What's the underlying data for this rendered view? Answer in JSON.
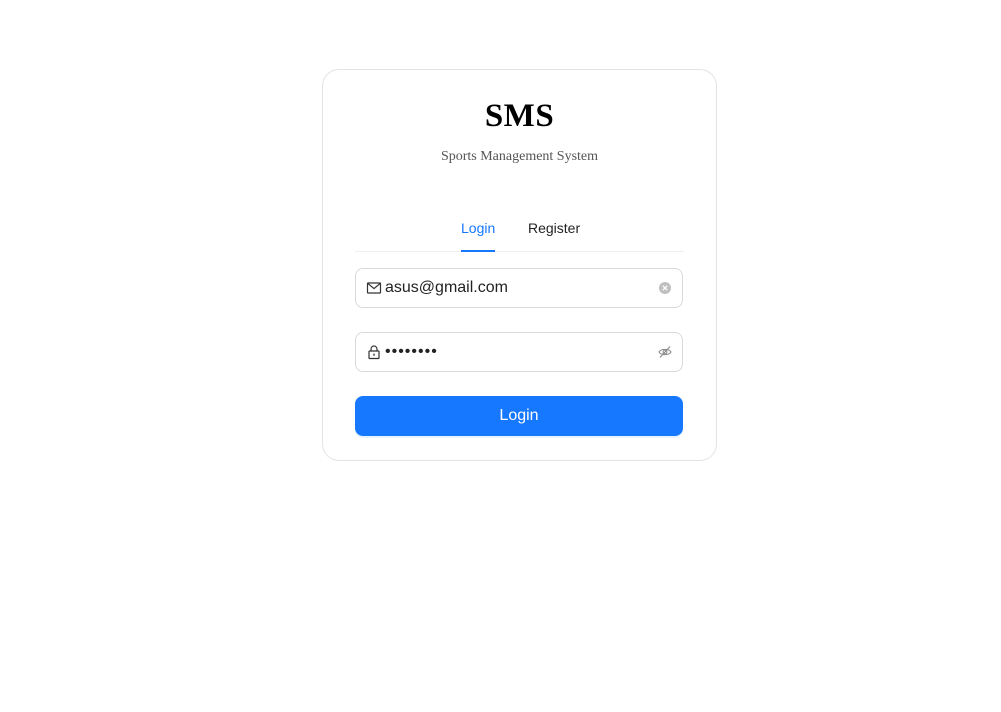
{
  "brand": {
    "title": "SMS",
    "subtitle": "Sports Management System"
  },
  "tabs": [
    {
      "label": "Login",
      "active": true
    },
    {
      "label": "Register",
      "active": false
    }
  ],
  "form": {
    "email": {
      "value": "asus@gmail.com",
      "icon": "mail-icon"
    },
    "password": {
      "value": "••••••••",
      "icon": "lock-icon",
      "toggle_icon": "eye-invisible-icon"
    },
    "submit_label": "Login"
  },
  "colors": {
    "primary": "#1677ff",
    "border": "#d9d9d9"
  }
}
